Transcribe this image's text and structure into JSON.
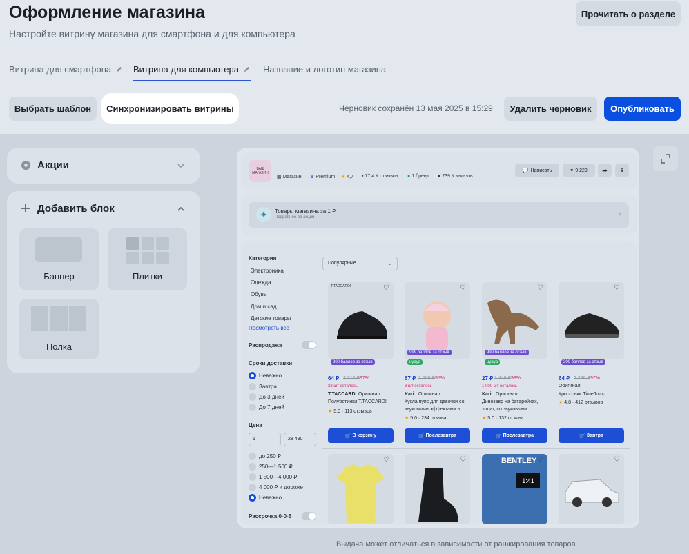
{
  "header": {
    "title": "Оформление магазина",
    "subtitle": "Настройте витрину магазина для смартфона и для компьютера",
    "read_button": "Прочитать о разделе"
  },
  "tabs": [
    {
      "label": "Витрина для смартфона",
      "active": false
    },
    {
      "label": "Витрина для компьютера",
      "active": true
    },
    {
      "label": "Название и логотип магазина",
      "active": false
    }
  ],
  "toolbar": {
    "choose_template": "Выбрать шаблон",
    "sync": "Синхронизировать витрины",
    "draft_note": "Черновик сохранён 13 мая 2025 в 15:29",
    "delete_draft": "Удалить черновик",
    "publish": "Опубликовать"
  },
  "left": {
    "promo_title": "Акции",
    "add_block_title": "Добавить блок",
    "blocks": [
      "Баннер",
      "Плитки",
      "Полка"
    ]
  },
  "store": {
    "logo_text": "ВАШ МАГАЗИН",
    "chips": [
      "Магазин",
      "Premium",
      "4,7",
      "77,4 К отзывов",
      "1 бренд",
      "739 К заказов"
    ],
    "write_button": "Написать",
    "likes": "9 229",
    "promo_title": "Товары магазина за 1 ₽",
    "promo_sub": "Подробнее об акции",
    "sort": "Популярные"
  },
  "filters": {
    "category_title": "Категория",
    "categories": [
      "Электроника",
      "Одежда",
      "Обувь",
      "Дом и сад",
      "Детские товары"
    ],
    "show_all": "Посмотреть все",
    "sale_label": "Распродажа",
    "delivery_title": "Сроки доставки",
    "delivery_options": [
      "Неважно",
      "Завтра",
      "До 3 дней",
      "До 7 дней"
    ],
    "price_title": "Цена",
    "price_from": "1",
    "price_to": "28 490",
    "price_options": [
      "до 250 ₽",
      "250—1 500 ₽",
      "1 500—4 000 ₽",
      "4 000 ₽ и дороже",
      "Неважно"
    ],
    "installment_label": "Рассрочка 0-0-6"
  },
  "products": [
    {
      "badge": "200 баллов за отзыв",
      "price": "64 ₽",
      "old": "2 312 ₽",
      "disc": "97%",
      "left": "23 шт осталось",
      "brand": "T.TACCARDI",
      "orig": "Оригинал",
      "name1": "Полуботинки T.TACCARDI",
      "name2": "",
      "rating": "5.0",
      "reviews": "113 отзывов",
      "cart": "В корзину"
    },
    {
      "badge": "999 баллов за отзыв",
      "tag": "uyaya",
      "price": "67 ₽",
      "old": "1 508 ₽",
      "disc": "95%",
      "left": "3 шт осталось",
      "brand": "Kari",
      "orig": "Оригинал",
      "name1": "Кукла пупс для девочки со",
      "name2": "звуковыми эффектами в...",
      "rating": "5.0",
      "reviews": "234 отзыва",
      "cart": "Послезавтра"
    },
    {
      "badge": "999 баллов за отзыв",
      "tag": "uyaya",
      "price": "27 ₽",
      "old": "1 446 ₽",
      "disc": "98%",
      "left": "1 000 шт осталось",
      "brand": "Kari",
      "orig": "Оригинал",
      "name1": "Динозавр на батарейках,",
      "name2": "ходит, со звуковыми...",
      "rating": "5.0",
      "reviews": "132 отзыва",
      "cart": "Послезавтра"
    },
    {
      "badge": "200 баллов за отзыв",
      "price": "64 ₽",
      "old": "2 226 ₽",
      "disc": "97%",
      "left": "",
      "brand": "",
      "orig": "Оригинал",
      "name1": "Кроссовки TimeJump",
      "name2": "",
      "rating": "4.8",
      "reviews": "412 отзывов",
      "cart": "Завтра"
    }
  ],
  "bottom_note": "Выдача может отличаться в зависимости от ранжирования товаров"
}
